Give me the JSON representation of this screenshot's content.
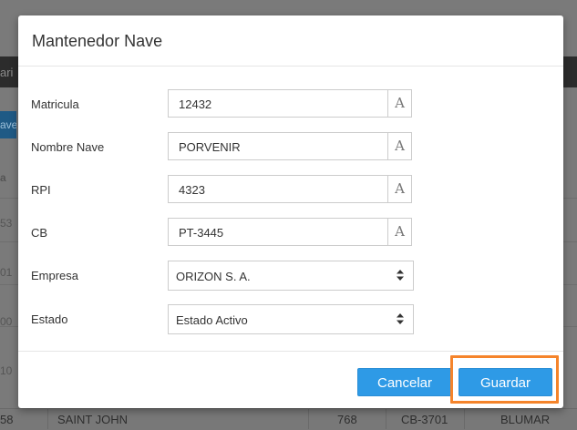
{
  "background": {
    "topbar_fragment": "ari",
    "button_fragment": "ave",
    "table_header_fragment": "a",
    "row_fragments": [
      "53",
      "01",
      "00",
      "10",
      "58"
    ],
    "last_row": {
      "name": "SAINT JOHN",
      "rpi": "768",
      "cb": "CB-3701",
      "empresa": "BLUMAR"
    }
  },
  "modal": {
    "title": "Mantenedor Nave",
    "fields": [
      {
        "label": "Matricula",
        "value": "12432",
        "addon": "A"
      },
      {
        "label": "Nombre Nave",
        "value": "PORVENIR",
        "addon": "A"
      },
      {
        "label": "RPI",
        "value": "4323",
        "addon": "A"
      },
      {
        "label": "CB",
        "value": "PT-3445",
        "addon": "A"
      }
    ],
    "selects": [
      {
        "label": "Empresa",
        "value": "ORIZON S. A."
      },
      {
        "label": "Estado",
        "value": "Estado Activo"
      }
    ],
    "footer": {
      "cancel_label": "Cancelar",
      "save_label": "Guardar"
    }
  },
  "colors": {
    "primary": "#2e9ae6",
    "highlight": "#f5842b",
    "overlay": "#7a7a7a"
  }
}
